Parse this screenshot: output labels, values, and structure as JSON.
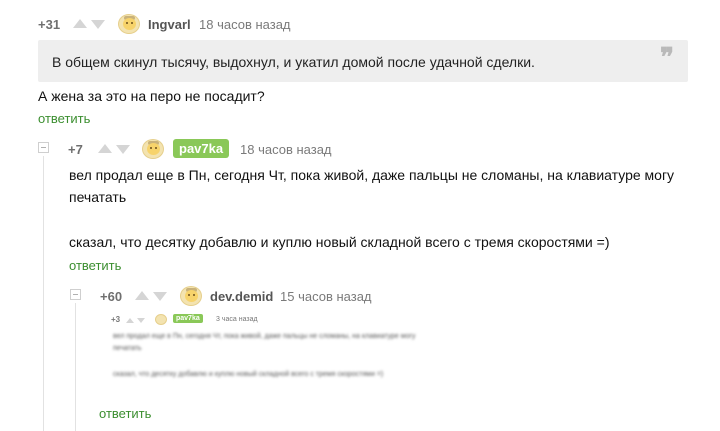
{
  "comment1": {
    "rating": "+31",
    "username": "Ingvarl",
    "time": "18 часов назад",
    "quote": "В общем скинул тысячу, выдохнул, и укатил домой после удачной сделки.",
    "quote_icon": "quote-icon",
    "text": "А жена за это на перо не посадит?",
    "reply": "ответить"
  },
  "comment2": {
    "rating": "+7",
    "username": "pav7ka",
    "time": "18 часов назад",
    "text_line1": "вел продал еще в Пн, сегодня Чт, пока живой, даже пальцы не сломаны, на клавиатуре могу",
    "text_line2": "печатать",
    "text_line3": "сказал, что десятку добавлю и куплю новый складной всего с тремя скоростями =)",
    "reply": "ответить"
  },
  "comment3": {
    "rating": "+60",
    "username": "dev.demid",
    "time": "15 часов назад",
    "embedded": {
      "rating": "+3",
      "username": "pav7ka",
      "time": "3 часа назад",
      "line1": "вел продал еще в Пн, сегодня Чт, пока живой, даже пальцы не сломаны, на клавиатуре могу",
      "line2": "печатать",
      "line3": "сказал, что десятку добавлю и куплю новый складной всего с тремя скоростями =)"
    },
    "reply": "ответить"
  },
  "colors": {
    "accent": "#3b8e2f",
    "author_badge": "#8ac858",
    "quote_bg": "#eeeeee"
  }
}
